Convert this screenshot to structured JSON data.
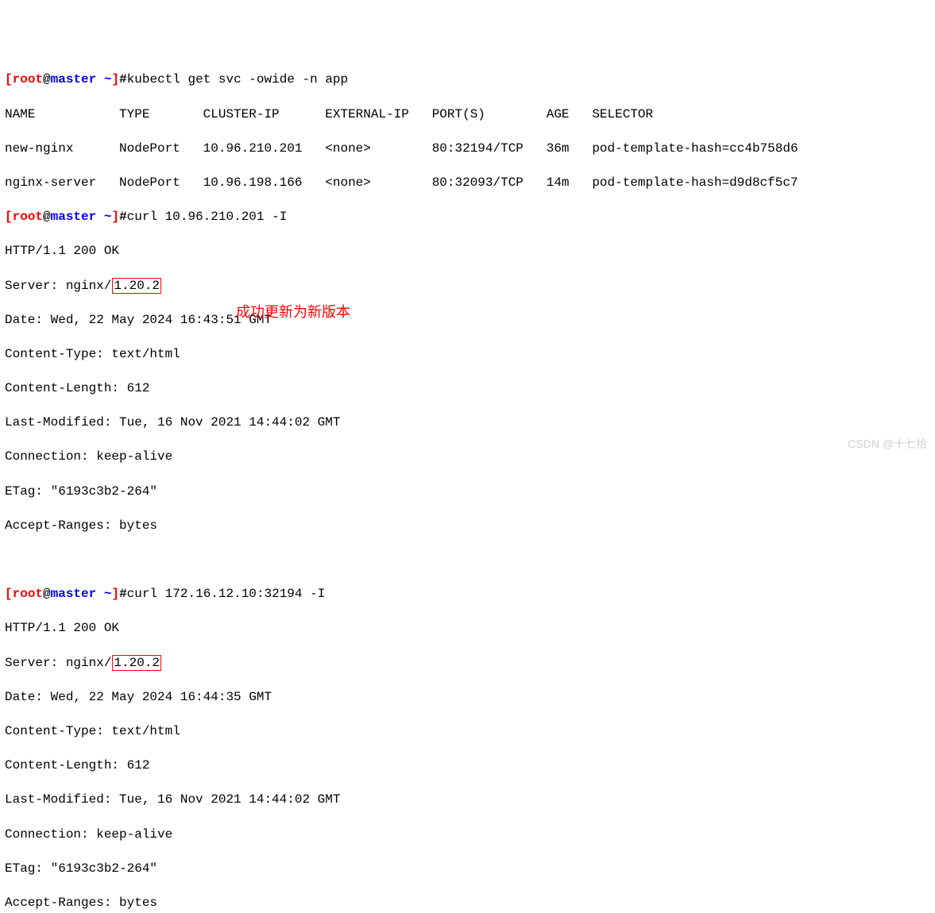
{
  "prompt": {
    "open_bracket": "[",
    "user": "root",
    "at": "@",
    "host": "master",
    "space": " ",
    "tilde": "~",
    "close_bracket": "]",
    "hash": "#"
  },
  "commands": {
    "cmd1": "kubectl get svc -owide -n app",
    "cmd2": "curl 10.96.210.201 -I",
    "cmd3": "curl 172.16.12.10:32194 -I"
  },
  "svc_table": {
    "header": "NAME           TYPE       CLUSTER-IP      EXTERNAL-IP   PORT(S)        AGE   SELECTOR",
    "row1": "new-nginx      NodePort   10.96.210.201   <none>        80:32194/TCP   36m   pod-template-hash=cc4b758d6",
    "row2": "nginx-server   NodePort   10.96.198.166   <none>        80:32093/TCP   14m   pod-template-hash=d9d8cf5c7"
  },
  "curl1": {
    "l1": "HTTP/1.1 200 OK",
    "server_prefix": "Server: nginx/",
    "server_version": "1.20.2",
    "l3": "Date: Wed, 22 May 2024 16:43:51 GMT",
    "l4": "Content-Type: text/html",
    "l5": "Content-Length: 612",
    "l6": "Last-Modified: Tue, 16 Nov 2021 14:44:02 GMT",
    "l7": "Connection: keep-alive",
    "l8": "ETag: \"6193c3b2-264\"",
    "l9": "Accept-Ranges: bytes"
  },
  "curl2": {
    "l1": "HTTP/1.1 200 OK",
    "server_prefix": "Server: nginx/",
    "server_version": "1.20.2",
    "l3": "Date: Wed, 22 May 2024 16:44:35 GMT",
    "l4": "Content-Type: text/html",
    "l5": "Content-Length: 612",
    "l6": "Last-Modified: Tue, 16 Nov 2021 14:44:02 GMT",
    "l7": "Connection: keep-alive",
    "l8": "ETag: \"6193c3b2-264\"",
    "l9": "Accept-Ranges: bytes"
  },
  "annotation": "成功更新为新版本",
  "watermark": "CSDN @十七拾"
}
